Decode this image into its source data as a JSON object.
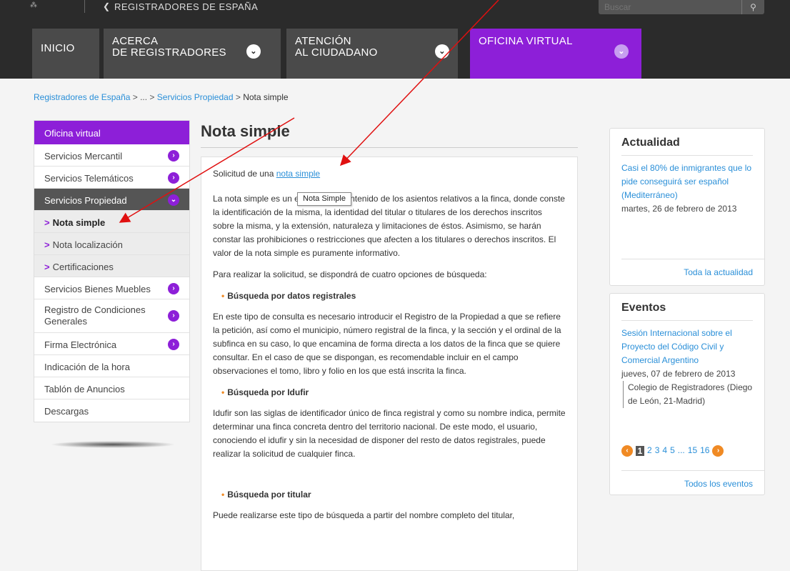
{
  "header": {
    "logo_text": "⁂",
    "site_name": "REGISTRADORES DE ESPAÑA",
    "search_placeholder": "Buscar",
    "search_icon": "search-icon",
    "nav": [
      {
        "line1": "INICIO",
        "line2": ""
      },
      {
        "line1": "ACERCA",
        "line2": "DE REGISTRADORES"
      },
      {
        "line1": "ATENCIÓN",
        "line2": "AL CIUDADANO"
      },
      {
        "line1": "OFICINA VIRTUAL",
        "line2": ""
      }
    ]
  },
  "breadcrumb": {
    "home": "Registradores de España",
    "sep1": " > ... > ",
    "section": "Servicios Propiedad",
    "sep2": " > ",
    "current": "Nota simple"
  },
  "sidebar": {
    "header": "Oficina virtual",
    "items": [
      {
        "label": "Servicios Mercantil"
      },
      {
        "label": "Servicios Telemáticos"
      },
      {
        "label": "Servicios Propiedad"
      },
      {
        "label": "Nota simple"
      },
      {
        "label": "Nota localización"
      },
      {
        "label": "Certificaciones"
      },
      {
        "label": "Servicios Bienes Muebles"
      },
      {
        "label": "Registro de Condiciones Generales"
      },
      {
        "label": "Firma Electrónica"
      },
      {
        "label": "Indicación de la hora"
      },
      {
        "label": "Tablón de Anuncios"
      },
      {
        "label": "Descargas"
      }
    ]
  },
  "main": {
    "title": "Nota simple",
    "intro_prefix": "Solicitud de una ",
    "intro_link": "nota simple",
    "tooltip": "Nota Simple",
    "p1": "La nota simple es un extracto del contenido de los asientos relativos a la finca, donde conste la identificación de la misma, la identidad del titular o titulares de los derechos inscritos sobre la misma, y la extensión, naturaleza y limitaciones de éstos. Asimismo, se harán constar las prohibiciones o restricciones que afecten a los titulares o derechos inscritos. El valor de la nota simple es puramente informativo.",
    "p2": "Para realizar la solicitud, se dispondrá de cuatro opciones de búsqueda:",
    "h1": "Búsqueda por datos registrales",
    "p3": "En este tipo de consulta es necesario introducir el Registro de la Propiedad a que se refiere la petición, así como el municipio, número registral de la finca, y la sección y el ordinal de la subfinca en su caso, lo que encamina de forma directa a los datos de la finca que se quiere consultar. En el caso de que se dispongan, es recomendable incluir en el campo observaciones el tomo, libro y folio en los que está inscrita la finca.",
    "h2": "Búsqueda por Idufir",
    "p4": "Idufir son las siglas de identificador único de finca registral y como su nombre indica, permite determinar una finca concreta dentro del territorio nacional. De este modo, el usuario, conociendo el idufir y sin la necesidad de disponer del resto de datos registrales, puede realizar la solicitud de cualquier finca.",
    "h3": "Búsqueda por titular",
    "p5": "Puede realizarse este tipo de búsqueda a partir del nombre completo del titular,"
  },
  "news": {
    "title": "Actualidad",
    "link": "Casi el 80% de inmigrantes que lo pide conseguirá ser español (Mediterráneo)",
    "date": "martes, 26 de febrero de 2013",
    "more": "Toda la actualidad"
  },
  "events": {
    "title": "Eventos",
    "link": "Sesión Internacional sobre el Proyecto del Código Civil y Comercial Argentino",
    "date": "jueves, 07 de febrero de 2013",
    "location": "Colegio de Registradores (Diego de León, 21-Madrid)",
    "pager": {
      "current": "1",
      "pages": [
        "2",
        "3",
        "4",
        "5"
      ],
      "ellipsis": "...",
      "last": [
        "15",
        "16"
      ]
    },
    "more": "Todos los eventos"
  },
  "colors": {
    "accent": "#8d1fd8",
    "header": "#2b2b2b",
    "link": "#2a8fd8",
    "bullet": "#f08a24",
    "annotation": "#e01010"
  }
}
